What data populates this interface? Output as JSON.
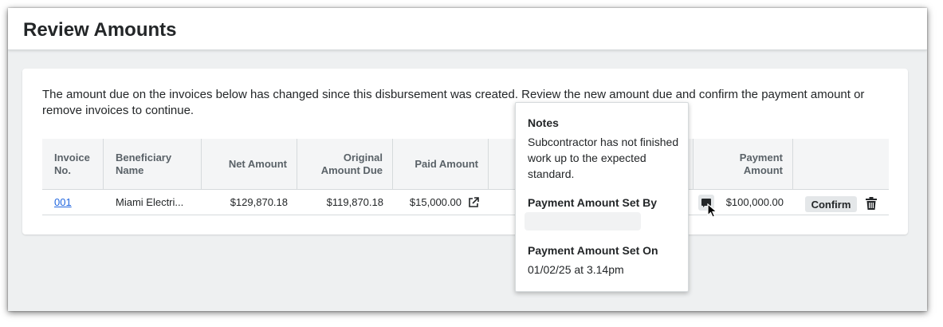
{
  "page": {
    "title": "Review Amounts",
    "message": "The amount due on the invoices below has changed since this disbursement was created. Review the new amount due and confirm the payment amount or remove invoices to continue."
  },
  "table": {
    "headers": {
      "invoice_no": "Invoice No.",
      "beneficiary_name": "Beneficiary Name",
      "net_amount": "Net Amount",
      "original_amount_due": "Original Amount Due",
      "paid_amount": "Paid Amount",
      "payment_amount": "Payment Amount"
    },
    "rows": [
      {
        "invoice_no": "001",
        "beneficiary_name": "Miami Electri...",
        "net_amount": "$129,870.18",
        "original_amount_due": "$119,870.18",
        "paid_amount": "$15,000.00",
        "payment_amount": "$100,000.00",
        "confirm_label": "Confirm"
      }
    ]
  },
  "popover": {
    "notes_title": "Notes",
    "notes_text": "Subcontractor has not finished work up to the expected standard.",
    "set_by_title": "Payment Amount Set By",
    "set_on_title": "Payment Amount Set On",
    "set_on_value": "01/02/25 at 3.14pm"
  },
  "icons": {
    "external_link": "external-link-icon",
    "notes": "comment-icon",
    "delete": "trash-icon",
    "cursor": "mouse-pointer"
  },
  "colors": {
    "link": "#2066df",
    "header_bg": "#f4f5f6",
    "page_bg": "#eef0f1"
  }
}
